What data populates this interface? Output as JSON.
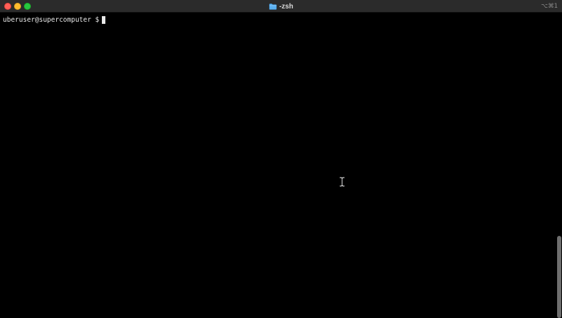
{
  "window": {
    "title": "-zsh",
    "title_icon": "folder-icon",
    "shortcut": "⌥⌘1"
  },
  "terminal": {
    "prompt": "uberuser@supercomputer $",
    "input": "",
    "background_color": "#000000",
    "text_color": "#e8e8e8"
  },
  "scrollbar": {
    "position": 1.0,
    "visible_fraction": 0.27
  },
  "colors": {
    "close": "#ff5f57",
    "minimize": "#febc2e",
    "zoom": "#28c840",
    "folder": "#5ab0f0"
  }
}
